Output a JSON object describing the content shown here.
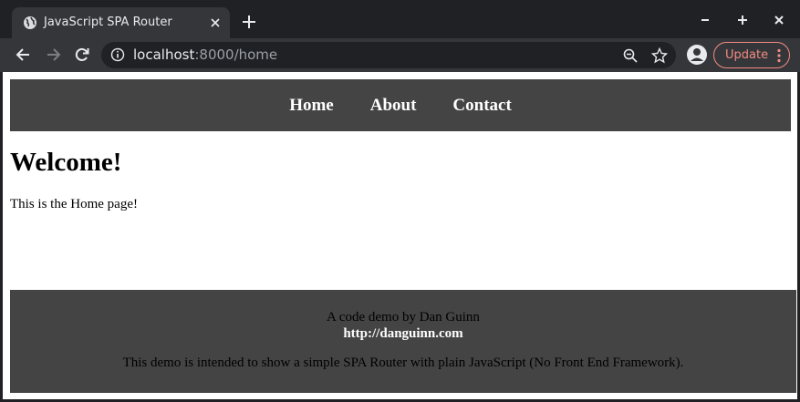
{
  "browser": {
    "tab": {
      "title": "JavaScript SPA Router",
      "favicon": "globe-icon"
    },
    "omnibox": {
      "host": "localhost",
      "rest": ":8000/home"
    },
    "update_label": "Update"
  },
  "page": {
    "nav": [
      {
        "label": "Home"
      },
      {
        "label": "About"
      },
      {
        "label": "Contact"
      }
    ],
    "heading": "Welcome!",
    "text": "This is the Home page!",
    "footer": {
      "credit": "A code demo by Dan Guinn",
      "link": "http://danguinn.com",
      "description": "This demo is intended to show a simple SPA Router with plain JavaScript (No Front End Framework)."
    }
  },
  "colors": {
    "chrome_dark": "#202124",
    "chrome_toolbar": "#35363a",
    "update_accent": "#f28b82",
    "site_bar": "#444444"
  }
}
